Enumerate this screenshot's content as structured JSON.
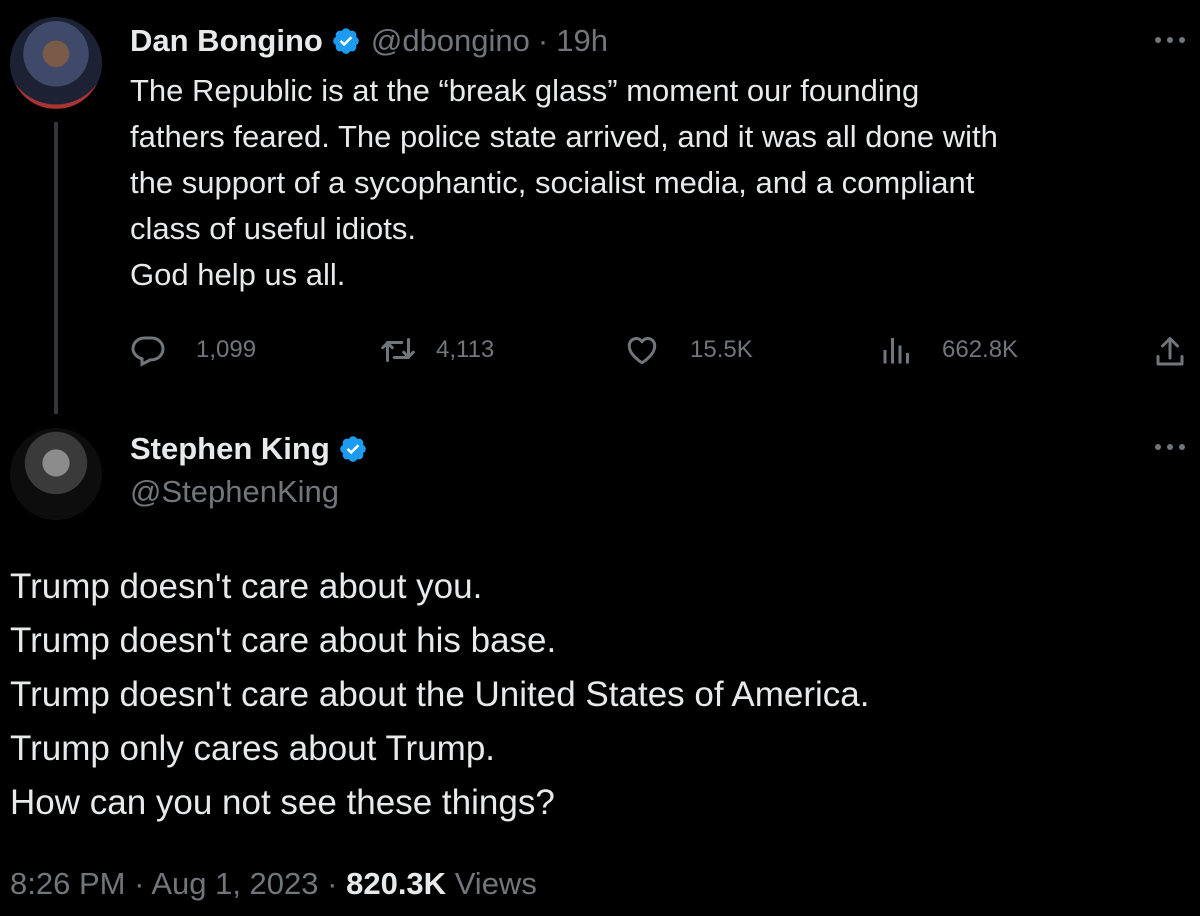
{
  "colors": {
    "background": "#000000",
    "text_primary": "#e7e9ea",
    "text_secondary": "#71767b",
    "verified_blue": "#1d9bf0",
    "thread_line": "#333639"
  },
  "parent_tweet": {
    "author": {
      "name": "Dan Bongino",
      "handle": "@dbongino",
      "verified": true
    },
    "separator": "·",
    "time": "19h",
    "lines": [
      "The Republic is at the “break glass” moment our founding",
      "fathers feared. The police state arrived, and it was all done with",
      "the support of a sycophantic, socialist media, and a compliant",
      "class of useful idiots.",
      "God help us all."
    ],
    "actions": {
      "replies": "1,099",
      "retweets": "4,113",
      "likes": "15.5K",
      "views": "662.8K"
    },
    "icons": [
      "reply-icon",
      "retweet-icon",
      "like-icon",
      "views-icon",
      "share-icon",
      "more-icon"
    ]
  },
  "main_tweet": {
    "author": {
      "name": "Stephen King",
      "handle": "@StephenKing",
      "verified": true
    },
    "lines": [
      "Trump doesn't care about you.",
      "Trump doesn't care about his base.",
      "Trump doesn't care about the United States of America.",
      "Trump only cares about Trump.",
      "How can you not see these things?"
    ],
    "meta": {
      "time": "8:26 PM",
      "separator": "·",
      "date": "Aug 1, 2023",
      "views_count": "820.3K",
      "views_label": "Views"
    }
  }
}
